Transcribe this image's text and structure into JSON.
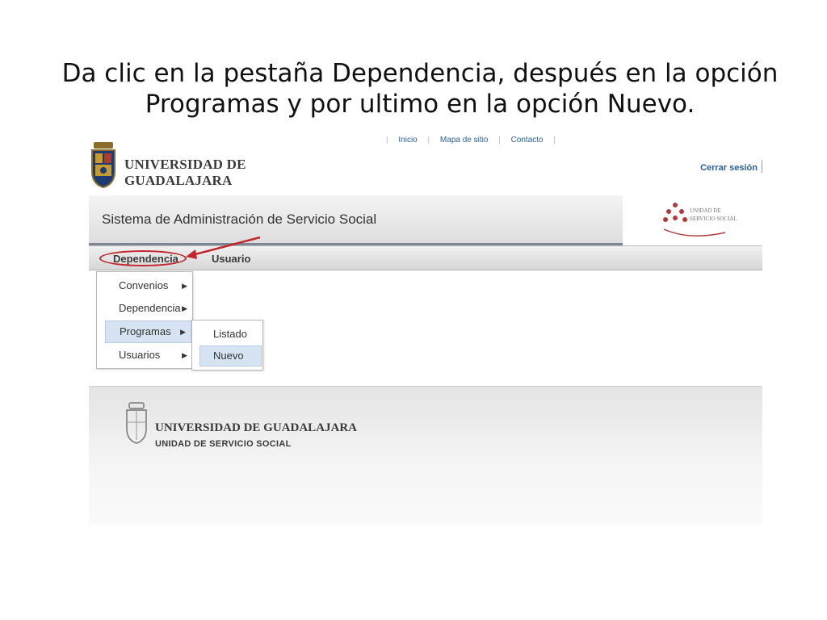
{
  "instruction": "Da clic en la pestaña Dependencia, después en la opción Programas y por ultimo en la opción Nuevo.",
  "header": {
    "university_name": "UNIVERSIDAD DE GUADALAJARA",
    "logout_label": "Cerrar sesión",
    "top_links": [
      "Inicio",
      "Mapa de sitio",
      "Contacto"
    ]
  },
  "banner": {
    "title": "Sistema de Administración de Servicio Social"
  },
  "unit_logo": {
    "line1": "UNIDAD DE",
    "line2": "SERVICIO SOCIAL"
  },
  "nav": {
    "tabs": [
      "Dependencia",
      "Usuario"
    ]
  },
  "menu": {
    "items": [
      "Convenios",
      "Dependencia",
      "Programas",
      "Usuarios"
    ],
    "active": "Programas"
  },
  "submenu": {
    "items": [
      "Listado",
      "Nuevo"
    ],
    "active": "Nuevo"
  },
  "footer": {
    "university_name": "UNIVERSIDAD DE GUADALAJARA",
    "unit_name": "UNIDAD DE SERVICIO SOCIAL"
  },
  "colors": {
    "highlight": "#c1272d",
    "menu_active": "#d6e3f3",
    "link": "#2b5f9e"
  }
}
